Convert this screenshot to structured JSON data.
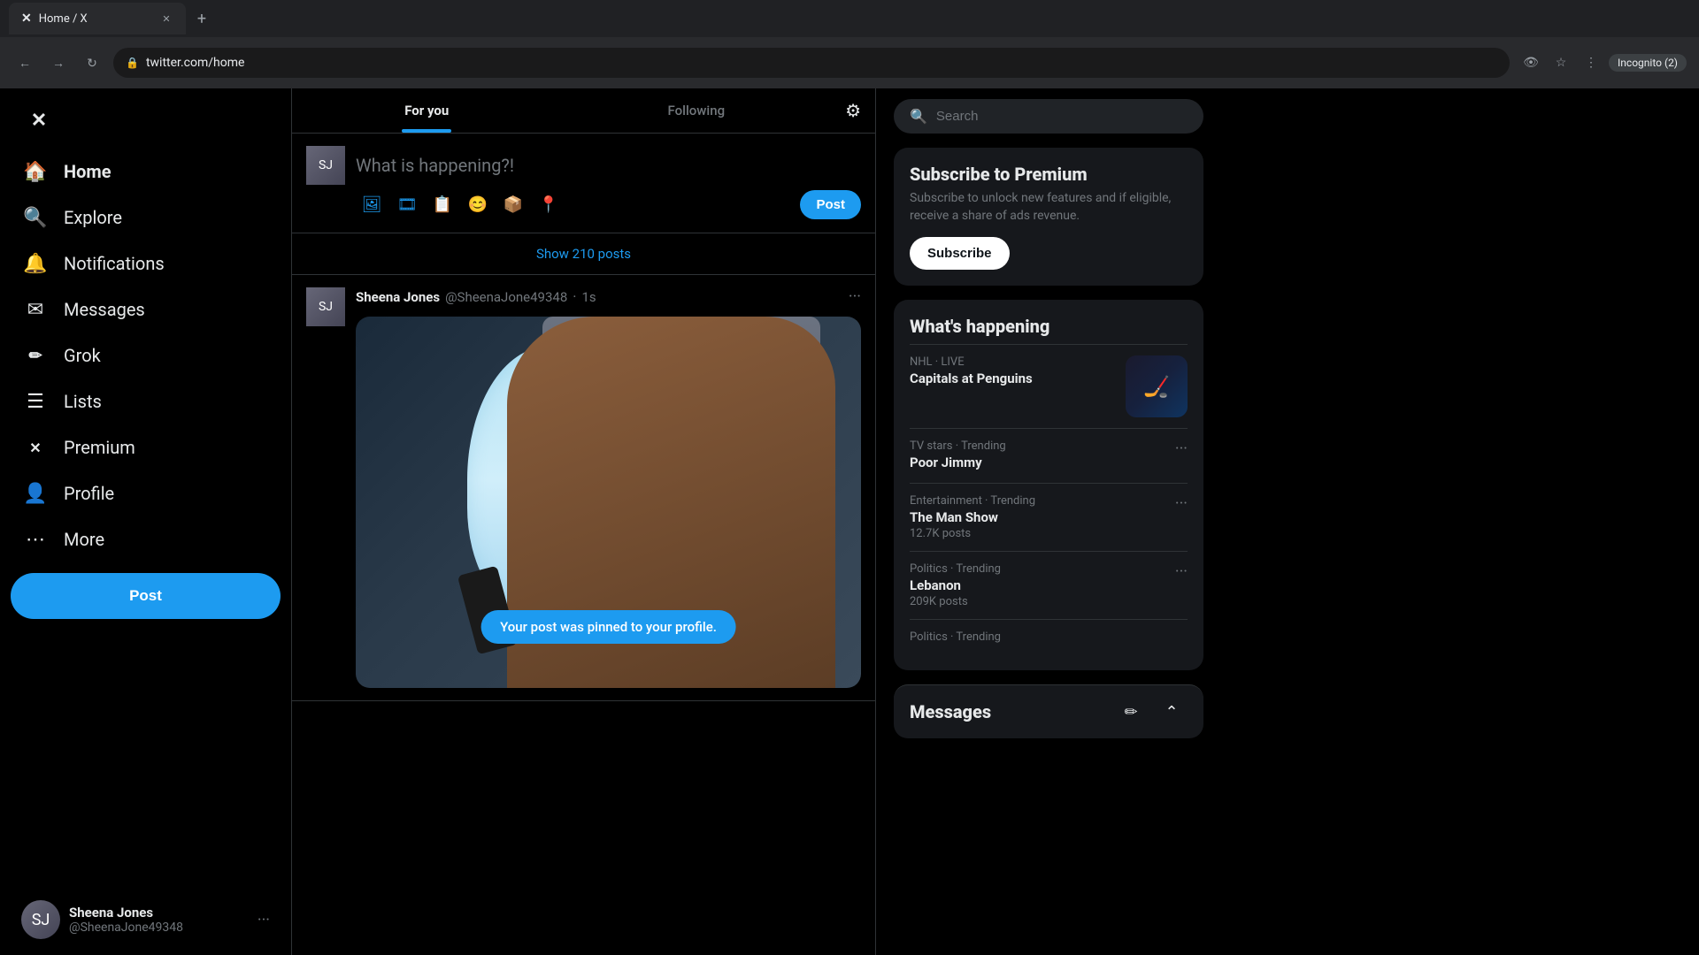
{
  "browser": {
    "tab_title": "Home / X",
    "url": "twitter.com/home",
    "incognito_label": "Incognito (2)"
  },
  "sidebar": {
    "logo": "✕",
    "nav_items": [
      {
        "id": "home",
        "label": "Home",
        "icon": "🏠",
        "active": true
      },
      {
        "id": "explore",
        "label": "Explore",
        "icon": "🔍",
        "active": false
      },
      {
        "id": "notifications",
        "label": "Notifications",
        "icon": "🔔",
        "active": false
      },
      {
        "id": "messages",
        "label": "Messages",
        "icon": "✉",
        "active": false
      },
      {
        "id": "grok",
        "label": "Grok",
        "icon": "✏",
        "active": false
      },
      {
        "id": "lists",
        "label": "Lists",
        "icon": "☰",
        "active": false
      },
      {
        "id": "premium",
        "label": "Premium",
        "icon": "✕",
        "active": false
      },
      {
        "id": "profile",
        "label": "Profile",
        "icon": "👤",
        "active": false
      },
      {
        "id": "more",
        "label": "More",
        "icon": "⋯",
        "active": false
      }
    ],
    "post_button_label": "Post",
    "user": {
      "name": "Sheena Jones",
      "handle": "@SheenaJone49348"
    }
  },
  "feed": {
    "tabs": [
      {
        "id": "for-you",
        "label": "For you",
        "active": true
      },
      {
        "id": "following",
        "label": "Following",
        "active": false
      }
    ],
    "compose": {
      "placeholder": "What is happening?!",
      "post_button": "Post",
      "actions": [
        "📷",
        "🎞",
        "📋",
        "😊",
        "📦",
        "📍"
      ]
    },
    "show_posts_label": "Show 210 posts",
    "tweet": {
      "author_name": "Sheena Jones",
      "author_handle": "@SheenaJone49348",
      "time": "1s",
      "pinned_toast": "Your post was pinned to your profile."
    }
  },
  "right": {
    "search_placeholder": "Search",
    "premium": {
      "title": "Subscribe to Premium",
      "description": "Subscribe to unlock new features and if eligible, receive a share of ads revenue.",
      "button_label": "Subscribe"
    },
    "whats_happening": {
      "title": "What's happening",
      "trends": [
        {
          "category": "NHL · LIVE",
          "name": "Capitals at Penguins",
          "count": "",
          "has_image": true
        },
        {
          "category": "TV stars · Trending",
          "name": "Poor Jimmy",
          "count": "",
          "has_image": false
        },
        {
          "category": "Entertainment · Trending",
          "name": "The Man Show",
          "count": "12.7K posts",
          "has_image": false
        },
        {
          "category": "Politics · Trending",
          "name": "Lebanon",
          "count": "209K posts",
          "has_image": false
        },
        {
          "category": "Politics · Trending",
          "name": "",
          "count": "",
          "has_image": false
        }
      ]
    },
    "messages_footer": {
      "title": "Messages"
    }
  }
}
